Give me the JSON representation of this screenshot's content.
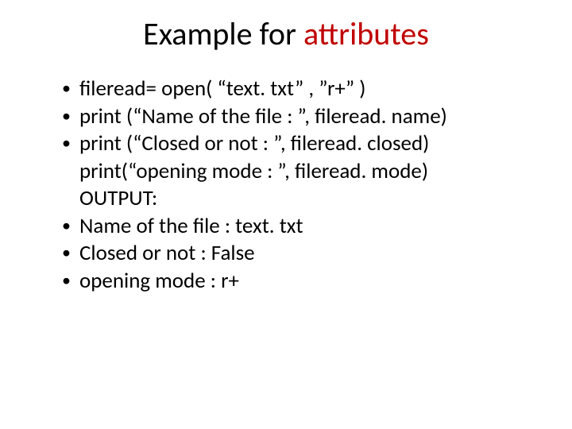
{
  "title": {
    "word1": "Example",
    "word2": "for",
    "word3": "attributes"
  },
  "bullets": {
    "b0": "fileread= open( “text. txt” , ”r+” )",
    "b1": "print (“Name of the file : ”, fileread. name)",
    "b2": "print (“Closed or not :  ”, fileread. closed)",
    "b2_line2": "print(“opening mode : ”, fileread. mode)",
    "b2_line3": "OUTPUT:",
    "b3": " Name of the file : text. txt",
    "b4": "Closed or not :  False",
    "b5": "opening mode : r+"
  }
}
